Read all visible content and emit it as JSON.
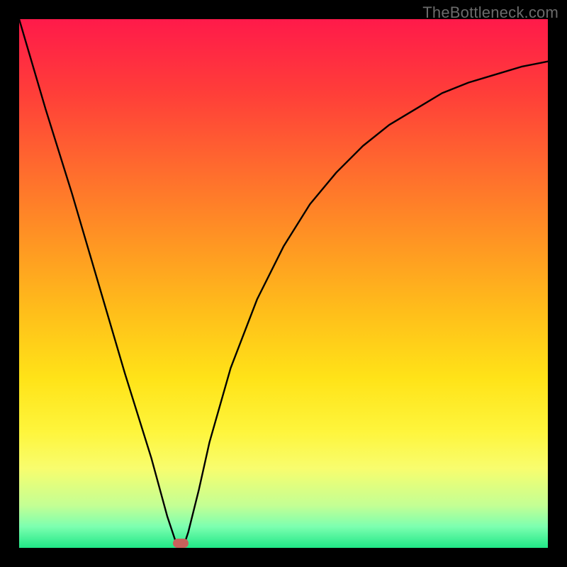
{
  "watermark": "TheBottleneck.com",
  "chart_data": {
    "type": "line",
    "title": "",
    "xlabel": "",
    "ylabel": "",
    "xlim": [
      0,
      100
    ],
    "ylim": [
      0,
      100
    ],
    "series": [
      {
        "name": "bottleneck-curve",
        "x": [
          0,
          5,
          10,
          15,
          20,
          25,
          28,
          30,
          31,
          32,
          34,
          36,
          40,
          45,
          50,
          55,
          60,
          65,
          70,
          75,
          80,
          85,
          90,
          95,
          100
        ],
        "values": [
          100,
          83,
          67,
          50,
          33,
          17,
          6,
          0,
          0,
          3,
          11,
          20,
          34,
          47,
          57,
          65,
          71,
          76,
          80,
          83,
          86,
          88,
          89.5,
          91,
          92
        ]
      }
    ],
    "marker": {
      "x": 30.5,
      "y": 0.8,
      "color": "#c9615c"
    },
    "background_gradient": {
      "stops": [
        {
          "pos": 0,
          "color": "#ff1a4a"
        },
        {
          "pos": 14,
          "color": "#ff3e39"
        },
        {
          "pos": 28,
          "color": "#ff6a2e"
        },
        {
          "pos": 42,
          "color": "#ff9523"
        },
        {
          "pos": 56,
          "color": "#ffc01a"
        },
        {
          "pos": 68,
          "color": "#ffe318"
        },
        {
          "pos": 78,
          "color": "#fef53c"
        },
        {
          "pos": 85,
          "color": "#f8fd6e"
        },
        {
          "pos": 92,
          "color": "#c3ff94"
        },
        {
          "pos": 96,
          "color": "#7cffb0"
        },
        {
          "pos": 100,
          "color": "#20e786"
        }
      ]
    }
  }
}
